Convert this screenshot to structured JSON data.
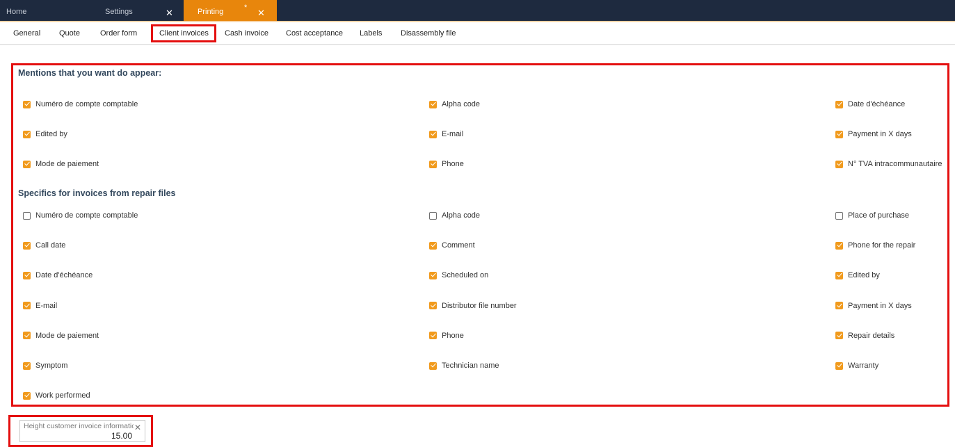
{
  "window_tabs": {
    "home": "Home",
    "settings": "Settings",
    "printing": "Printing",
    "modified_mark": "*",
    "close_glyph": "✕"
  },
  "subnav": [
    "General",
    "Quote",
    "Order form",
    "Client invoices",
    "Cash invoice",
    "Cost acceptance",
    "Labels",
    "Disassembly file"
  ],
  "selected_subtab": "Client invoices",
  "sections": {
    "mentions": {
      "title": "Mentions that you want do appear:",
      "items": [
        {
          "label": "Numéro de compte comptable",
          "checked": true
        },
        {
          "label": "Alpha code",
          "checked": true
        },
        {
          "label": "Date d'échéance",
          "checked": true
        },
        {
          "label": "Edited by",
          "checked": true
        },
        {
          "label": "E-mail",
          "checked": true
        },
        {
          "label": "Payment in X days",
          "checked": true
        },
        {
          "label": "Mode de paiement",
          "checked": true
        },
        {
          "label": "Phone",
          "checked": true
        },
        {
          "label": "N° TVA intracommunautaire",
          "checked": true
        }
      ]
    },
    "repair": {
      "title": "Specifics for invoices from repair files",
      "items": [
        {
          "label": "Numéro de compte comptable",
          "checked": false
        },
        {
          "label": "Alpha code",
          "checked": false
        },
        {
          "label": "Place of purchase",
          "checked": false
        },
        {
          "label": "Call date",
          "checked": true
        },
        {
          "label": "Comment",
          "checked": true
        },
        {
          "label": "Phone for the repair",
          "checked": true
        },
        {
          "label": "Date d'échéance",
          "checked": true
        },
        {
          "label": "Scheduled on",
          "checked": true
        },
        {
          "label": "Edited by",
          "checked": true
        },
        {
          "label": "E-mail",
          "checked": true
        },
        {
          "label": "Distributor file number",
          "checked": true
        },
        {
          "label": "Payment in X days",
          "checked": true
        },
        {
          "label": "Mode de paiement",
          "checked": true
        },
        {
          "label": "Phone",
          "checked": true
        },
        {
          "label": "Repair details",
          "checked": true
        },
        {
          "label": "Symptom",
          "checked": true
        },
        {
          "label": "Technician name",
          "checked": true
        },
        {
          "label": "Warranty",
          "checked": true
        },
        {
          "label": "Work performed",
          "checked": true
        }
      ]
    }
  },
  "height_field": {
    "label": "Height customer invoice information",
    "value": "15.00",
    "clear_glyph": "✕"
  },
  "colors": {
    "topbar": "#1e2a3f",
    "accent": "#e8860c",
    "checkbox_on": "#f19a1c",
    "highlight": "#e40f0f",
    "section_title": "#34495e"
  }
}
